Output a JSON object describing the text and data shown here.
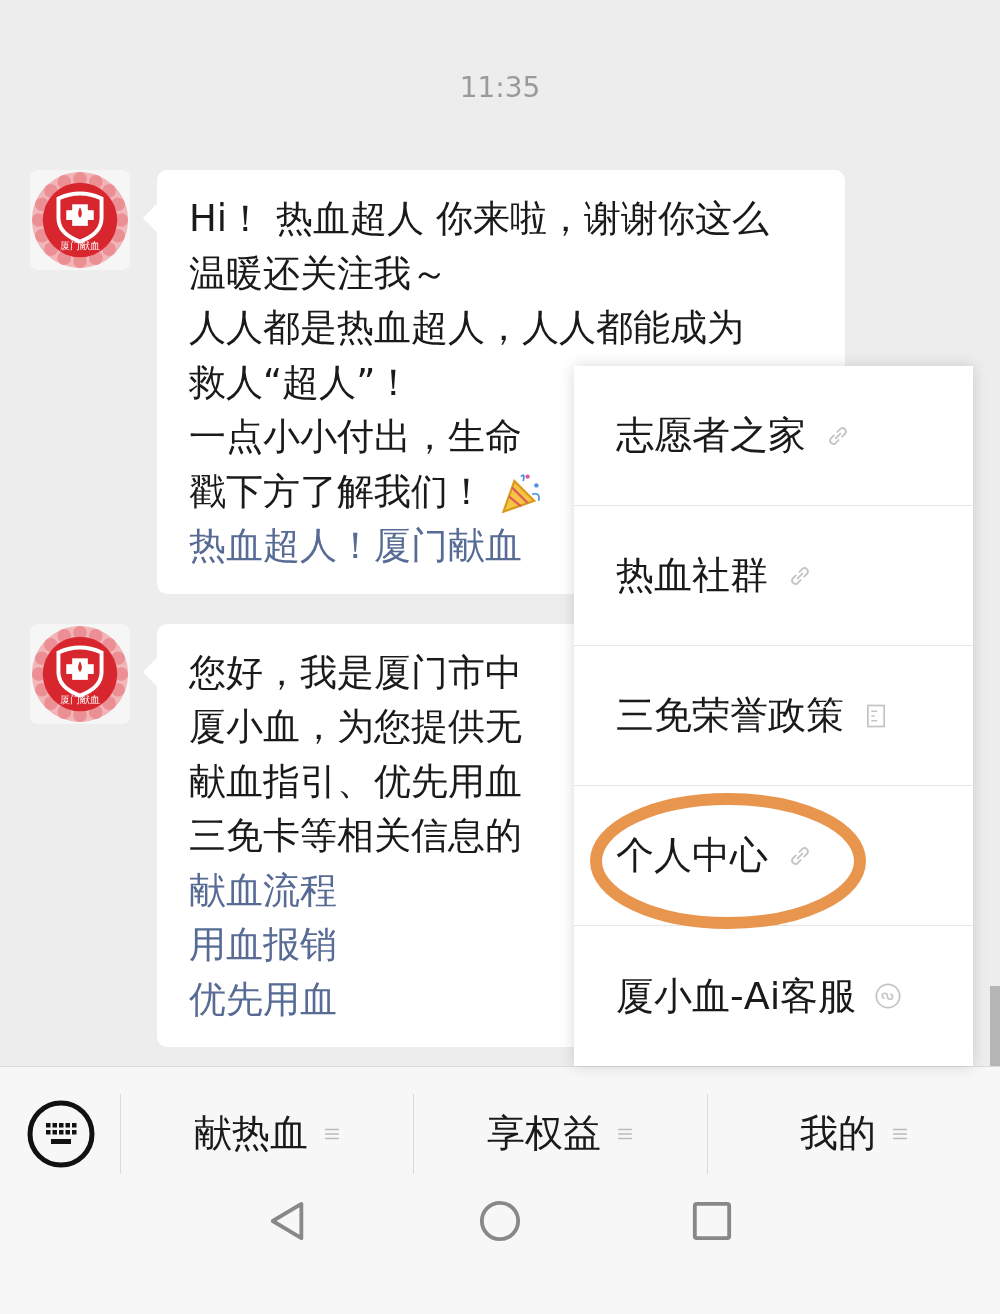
{
  "time": "11:35",
  "messages": [
    {
      "avatar_label": "厦门献血",
      "lines": [
        {
          "kind": "text",
          "text": "Hi！ 热血超人 你来啦，谢谢你这么"
        },
        {
          "kind": "text",
          "text": "温暖还关注我～"
        },
        {
          "kind": "text",
          "text": "人人都是热血超人，人人都能成为"
        },
        {
          "kind": "text",
          "text": "救人“超人”！"
        },
        {
          "kind": "text",
          "text": "一点小小付出，生命"
        },
        {
          "kind": "text_party",
          "text": "戳下方了解我们！"
        },
        {
          "kind": "link",
          "text": "热血超人！厦门献血"
        }
      ]
    },
    {
      "avatar_label": "厦门献血",
      "lines": [
        {
          "kind": "text",
          "text": "您好，我是厦门市中"
        },
        {
          "kind": "text",
          "text": "厦小血，为您提供无"
        },
        {
          "kind": "text",
          "text": "献血指引、优先用血"
        },
        {
          "kind": "text",
          "text": "三免卡等相关信息的"
        },
        {
          "kind": "link",
          "text": "献血流程"
        },
        {
          "kind": "link",
          "text": "用血报销"
        },
        {
          "kind": "link",
          "text": "优先用血"
        }
      ]
    }
  ],
  "popup_menu": [
    {
      "label": "志愿者之家",
      "kind": "link",
      "circled": false
    },
    {
      "label": "热血社群",
      "kind": "link",
      "circled": false
    },
    {
      "label": "三免荣誉政策",
      "kind": "article",
      "circled": false
    },
    {
      "label": "个人中心",
      "kind": "link",
      "circled": true
    },
    {
      "label": "厦小血-Ai客服",
      "kind": "miniapp",
      "circled": false
    }
  ],
  "bottom_menu": [
    {
      "label": "献热血"
    },
    {
      "label": "享权益"
    },
    {
      "label": "我的"
    }
  ]
}
